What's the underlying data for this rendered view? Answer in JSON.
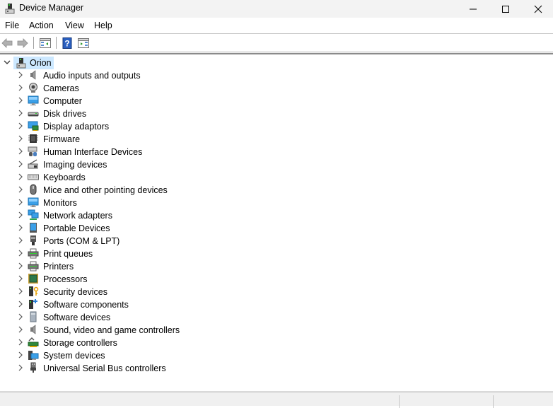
{
  "window": {
    "title": "Device Manager",
    "controls": {
      "minimize": "minimize",
      "maximize": "maximize",
      "close": "close"
    }
  },
  "menubar": {
    "items": [
      {
        "label": "File"
      },
      {
        "label": "Action"
      },
      {
        "label": "View"
      },
      {
        "label": "Help"
      }
    ]
  },
  "toolbar": {
    "buttons": [
      {
        "name": "back",
        "icon": "arrow-left-icon",
        "enabled": false
      },
      {
        "name": "forward",
        "icon": "arrow-right-icon",
        "enabled": false
      },
      {
        "name": "show-hide-console-tree",
        "icon": "console-tree-icon"
      },
      {
        "name": "help",
        "icon": "help-icon"
      },
      {
        "name": "show-hide-action-pane",
        "icon": "action-pane-icon"
      }
    ]
  },
  "tree": {
    "root": {
      "label": "Orion",
      "icon": "computer-tower-icon",
      "expanded": true,
      "selected": true
    },
    "categories": [
      {
        "label": "Audio inputs and outputs",
        "icon": "speaker-icon"
      },
      {
        "label": "Cameras",
        "icon": "webcam-icon"
      },
      {
        "label": "Computer",
        "icon": "monitor-icon"
      },
      {
        "label": "Disk drives",
        "icon": "disk-drive-icon"
      },
      {
        "label": "Display adaptors",
        "icon": "display-adapter-icon"
      },
      {
        "label": "Firmware",
        "icon": "chip-icon"
      },
      {
        "label": "Human Interface Devices",
        "icon": "hid-icon"
      },
      {
        "label": "Imaging devices",
        "icon": "scanner-icon"
      },
      {
        "label": "Keyboards",
        "icon": "keyboard-icon"
      },
      {
        "label": "Mice and other pointing devices",
        "icon": "mouse-icon"
      },
      {
        "label": "Monitors",
        "icon": "monitor-icon"
      },
      {
        "label": "Network adapters",
        "icon": "network-icon"
      },
      {
        "label": "Portable Devices",
        "icon": "portable-device-icon"
      },
      {
        "label": "Ports (COM & LPT)",
        "icon": "port-icon"
      },
      {
        "label": "Print queues",
        "icon": "printer-icon"
      },
      {
        "label": "Printers",
        "icon": "printer-icon"
      },
      {
        "label": "Processors",
        "icon": "processor-icon"
      },
      {
        "label": "Security devices",
        "icon": "security-key-icon"
      },
      {
        "label": "Software components",
        "icon": "software-component-icon"
      },
      {
        "label": "Software devices",
        "icon": "software-device-icon"
      },
      {
        "label": "Sound, video and game controllers",
        "icon": "speaker-icon"
      },
      {
        "label": "Storage controllers",
        "icon": "storage-controller-icon"
      },
      {
        "label": "System devices",
        "icon": "system-devices-icon"
      },
      {
        "label": "Universal Serial Bus controllers",
        "icon": "usb-icon"
      }
    ]
  },
  "statusbar": {
    "panes": [
      "",
      "",
      ""
    ]
  }
}
